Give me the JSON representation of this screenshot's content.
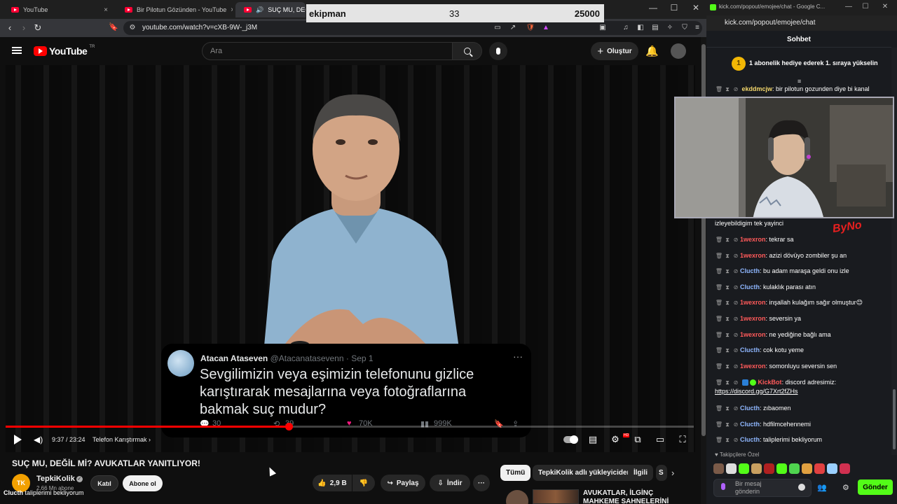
{
  "left_browser": {
    "tabs": [
      {
        "title": "YouTube"
      },
      {
        "title": "Bir Pilotun Gözünden - YouTube"
      },
      {
        "title": "SUÇ MU, DEĞİL Mİ"
      }
    ],
    "url": "youtube.com/watch?v=cXB-9W-_j3M"
  },
  "overlay": {
    "label": "ekipman",
    "value_a": "33",
    "value_b": "25000"
  },
  "youtube": {
    "logo_text": "YouTube",
    "logo_region": "TR",
    "search_placeholder": "Ara",
    "create_label": "Oluştur"
  },
  "video": {
    "time": "9:37 / 23:24",
    "chapter": "Telefon Karıştırmak",
    "progress_fraction": 0.411,
    "tweet": {
      "name": "Atacan Ataseven",
      "handle": "@Atacanatasevenn",
      "date": "· Sep 1",
      "text": "Sevgilimizin veya eşimizin telefonunu gizlice karıştırarak mesajlarına veya fotoğraflarına bakmak suç mudur?",
      "replies": "30",
      "retweets": "39",
      "likes": "70K",
      "views": "999K"
    }
  },
  "below": {
    "title": "SUÇ MU, DEĞİL Mİ? AVUKATLAR YANITLIYOR!",
    "channel_initials": "TK",
    "channel_name": "TepkiKolik",
    "subs": "2,66 Mn abone",
    "join": "Katıl",
    "subscribe": "Abone ol",
    "likes": "2,9 B",
    "share": "Paylaş",
    "download": "İndir",
    "more": "···",
    "chips": [
      "Tümü",
      "TepkiKolik adlı yükleyiciden",
      "İlgili",
      "S"
    ],
    "rec_title": "AVUKATLAR, İLGİNÇ MAHKEME SAHNELERİNİ İZLİYOR!",
    "caption_user": "Clucth",
    "caption_text": "taliplerimi bekliyorum"
  },
  "right_browser": {
    "title": "kick.com/popout/emojee/chat - Google C...",
    "url": "kick.com/popout/emojee/chat",
    "chat_title": "Sohbet",
    "banner_rank": "1",
    "banner_text": "1 abonelik hediye ederek 1. sıraya yükselin",
    "first_message": {
      "user": "ekddmcjw",
      "text": "bir pilotun gozunden diye bi kanal"
    },
    "continued_text": "izleyebildigim tek yayinci",
    "messages": [
      {
        "user": "1wexron",
        "text": "tekrar sa",
        "color": "#ff5a5a"
      },
      {
        "user": "1wexron",
        "text": "azizi dövüyo zombiler şu an",
        "color": "#ff5a5a"
      },
      {
        "user": "Clucth",
        "text": "bu adam maraşa geldi onu izle",
        "color": "#8fb7ff"
      },
      {
        "user": "Clucth",
        "text": "kulaklık parası atın",
        "color": "#8fb7ff"
      },
      {
        "user": "1wexron",
        "text": "inşallah kulağım sağır olmuştur😊",
        "color": "#ff5a5a"
      },
      {
        "user": "1wexron",
        "text": "seversin ya",
        "color": "#ff5a5a"
      },
      {
        "user": "1wexron",
        "text": "ne yediğine bağlı ama",
        "color": "#ff5a5a"
      },
      {
        "user": "Clucth",
        "text": "cok kotu yeme",
        "color": "#8fb7ff"
      },
      {
        "user": "1wexron",
        "text": "somonluyu seversin sen",
        "color": "#ff5a5a"
      }
    ],
    "bot_message": {
      "user": "KickBot",
      "text": "discord adresimiz:",
      "link": "https://discord.gg/G7Xrt2fZHs",
      "color": "#ff5a5a"
    },
    "late_messages": [
      {
        "user": "Clucth",
        "text": "zıbaomen",
        "color": "#8fb7ff"
      },
      {
        "user": "Clucth",
        "text": "hdfilmcehennemi",
        "color": "#8fb7ff"
      },
      {
        "user": "Clucth",
        "text": "taliplerimi bekliyorum",
        "color": "#8fb7ff"
      }
    ],
    "followers_label": "Takipçilere Özel",
    "input_placeholder": "Bir mesaj gönderin",
    "send_label": "Gönder",
    "overlay_logo": "ByNo"
  },
  "colors": {
    "youtube_red": "#ff0000",
    "kick_green": "#53fc18",
    "gold": "#f2b705"
  }
}
